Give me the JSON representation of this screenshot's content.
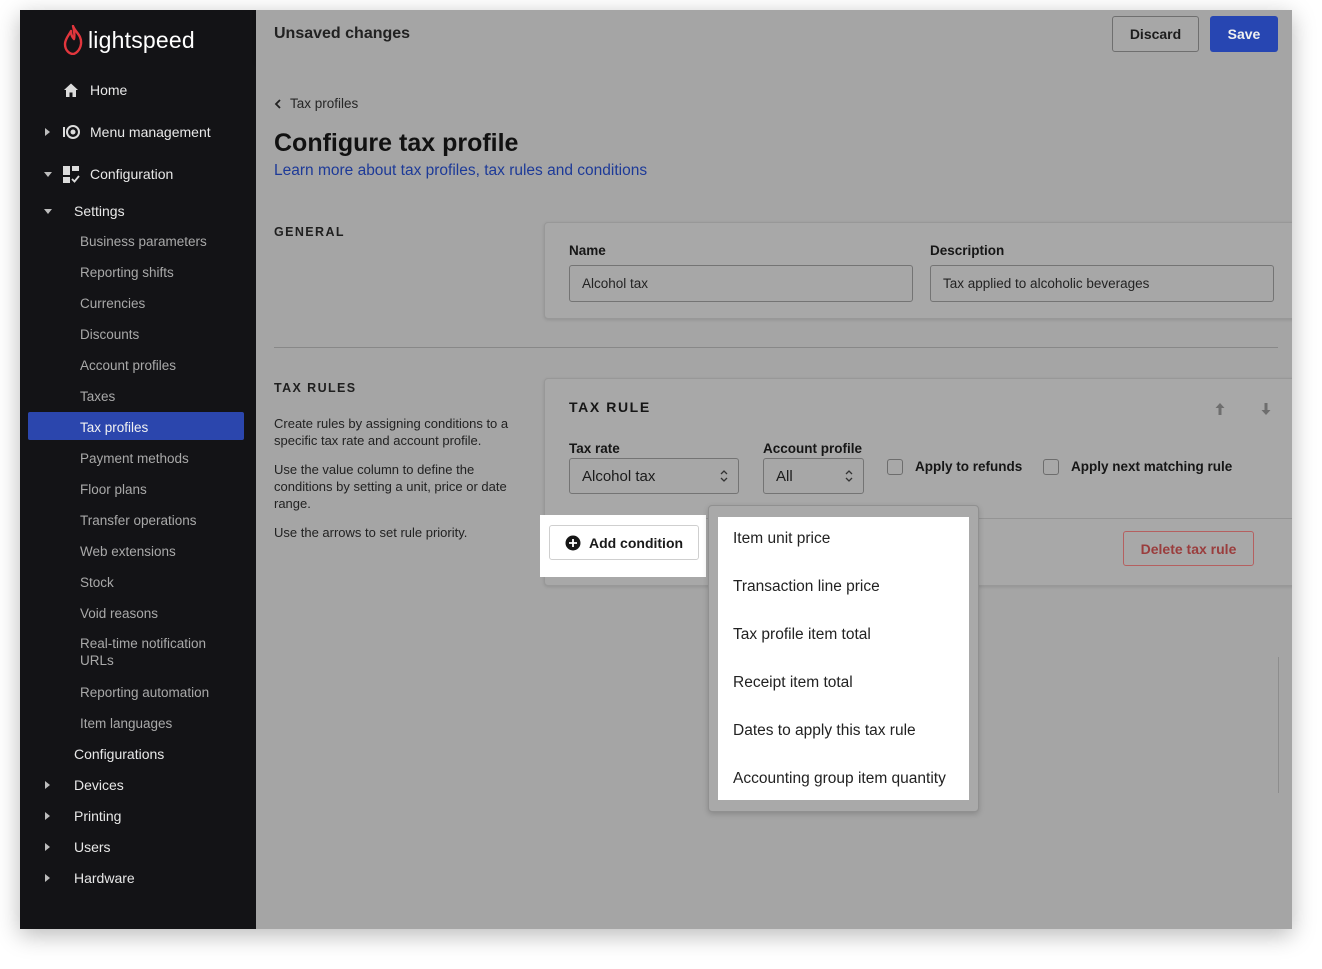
{
  "app": {
    "logo_text": "lightspeed"
  },
  "topbar": {
    "title": "Unsaved changes",
    "discard_label": "Discard",
    "save_label": "Save"
  },
  "sidebar": {
    "home": "Home",
    "menu_management": "Menu management",
    "configuration": "Configuration",
    "settings": "Settings",
    "settings_items": [
      "Business parameters",
      "Reporting shifts",
      "Currencies",
      "Discounts",
      "Account profiles",
      "Taxes",
      "Tax profiles",
      "Payment methods",
      "Floor plans",
      "Transfer operations",
      "Web extensions",
      "Stock",
      "Void reasons",
      "Real-time notification URLs",
      "Reporting automation",
      "Item languages"
    ],
    "configurations": "Configurations",
    "devices": "Devices",
    "printing": "Printing",
    "users": "Users",
    "hardware": "Hardware",
    "active_item": "Tax profiles"
  },
  "page": {
    "breadcrumb": "Tax profiles",
    "title": "Configure tax profile",
    "learn_link": "Learn more about tax profiles, tax rules and conditions"
  },
  "general": {
    "label": "GENERAL",
    "name_label": "Name",
    "name_value": "Alcohol tax",
    "description_label": "Description",
    "description_value": "Tax applied to alcoholic beverages"
  },
  "tax_rules": {
    "label": "TAX RULES",
    "help_1": "Create rules by assigning conditions to a specific tax rate and account profile.",
    "help_2": "Use the value column to define the conditions by setting a unit, price or date range.",
    "help_3": "Use the arrows to set rule priority."
  },
  "tax_rule": {
    "heading": "TAX RULE",
    "tax_rate_label": "Tax rate",
    "tax_rate_value": "Alcohol tax",
    "account_profile_label": "Account profile",
    "account_profile_value": "All",
    "apply_refunds_label": "Apply to refunds",
    "apply_next_label": "Apply next matching rule",
    "add_condition_label": "Add condition",
    "delete_label": "Delete tax rule"
  },
  "condition_menu": [
    "Item unit price",
    "Transaction line price",
    "Tax profile item total",
    "Receipt item total",
    "Dates to apply this tax rule",
    "Accounting group item quantity"
  ],
  "colors": {
    "accent": "#2b46ad",
    "sidebar_bg": "#131316",
    "danger": "#9a3d3d"
  }
}
